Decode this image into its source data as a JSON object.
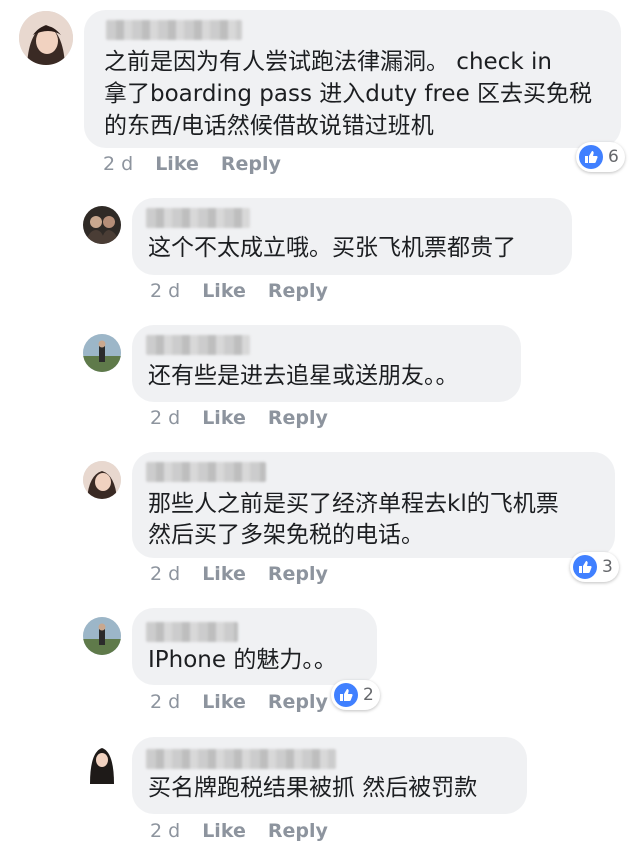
{
  "comments": [
    {
      "lines": [
        "之前是因为有人尝试跑法律漏洞。 check in",
        "拿了boarding pass 进入duty free 区去买免税",
        "的东西/电话然候借故说错过班机"
      ],
      "time": "2 d",
      "like": "Like",
      "reply": "Reply",
      "reactions": "6"
    },
    {
      "lines": [
        "这个不太成立哦。买张飞机票都贵了"
      ],
      "time": "2 d",
      "like": "Like",
      "reply": "Reply"
    },
    {
      "lines": [
        "还有些是进去追星或送朋友。。"
      ],
      "time": "2 d",
      "like": "Like",
      "reply": "Reply"
    },
    {
      "lines": [
        "那些人之前是买了经济单程去kl的飞机票",
        "然后买了多架免税的电话。"
      ],
      "time": "2 d",
      "like": "Like",
      "reply": "Reply",
      "reactions": "3"
    },
    {
      "lines": [
        "IPhone 的魅力。。"
      ],
      "time": "2 d",
      "like": "Like",
      "reply": "Reply",
      "reactions": "2"
    },
    {
      "lines": [
        "买名牌跑税结果被抓 然后被罚款"
      ],
      "time": "2 d",
      "like": "Like",
      "reply": "Reply"
    }
  ],
  "colors": {
    "bubble": "#f0f1f3",
    "meta": "#8d949e",
    "like_blue": "#4080ff"
  }
}
